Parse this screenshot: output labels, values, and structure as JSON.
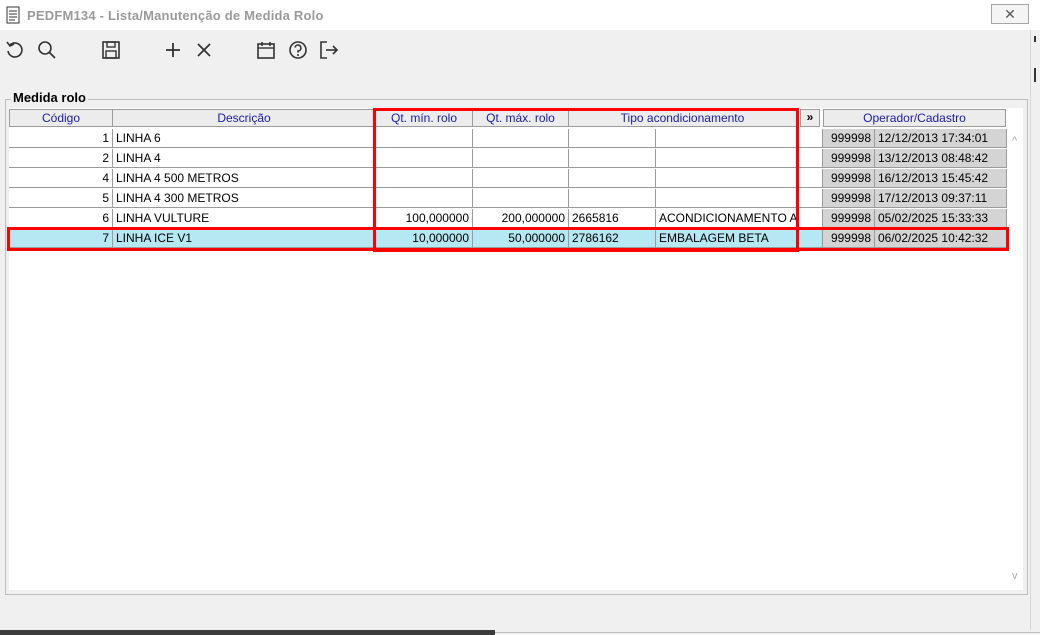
{
  "window": {
    "title": "PEDFM134 - Lista/Manutenção de Medida Rolo",
    "close_label": "✕"
  },
  "toolbar": {
    "icons": [
      "undo-icon",
      "search-icon",
      "save-icon",
      "add-icon",
      "delete-icon",
      "calendar-icon",
      "help-icon",
      "exit-icon"
    ]
  },
  "group": {
    "label": "Medida rolo"
  },
  "table": {
    "headers": {
      "codigo": "Código",
      "descricao": "Descrição",
      "qt_min": "Qt. mín. rolo",
      "qt_max": "Qt. máx. rolo",
      "tipo": "Tipo acondicionamento",
      "more": "»",
      "operador": "Operador/Cadastro"
    },
    "rows": [
      {
        "codigo": "1",
        "descricao": "LINHA 6",
        "qt_min": "",
        "qt_max": "",
        "tipo_cod": "",
        "tipo_desc": "",
        "operador": "999998",
        "cadastro": "12/12/2013 17:34:01"
      },
      {
        "codigo": "2",
        "descricao": "LINHA 4",
        "qt_min": "",
        "qt_max": "",
        "tipo_cod": "",
        "tipo_desc": "",
        "operador": "999998",
        "cadastro": "13/12/2013 08:48:42"
      },
      {
        "codigo": "4",
        "descricao": "LINHA 4 500 METROS",
        "qt_min": "",
        "qt_max": "",
        "tipo_cod": "",
        "tipo_desc": "",
        "operador": "999998",
        "cadastro": "16/12/2013 15:45:42"
      },
      {
        "codigo": "5",
        "descricao": "LINHA 4 300 METROS",
        "qt_min": "",
        "qt_max": "",
        "tipo_cod": "",
        "tipo_desc": "",
        "operador": "999998",
        "cadastro": "17/12/2013 09:37:11"
      },
      {
        "codigo": "6",
        "descricao": "LINHA VULTURE",
        "qt_min": "100,000000",
        "qt_max": "200,000000",
        "tipo_cod": "2665816",
        "tipo_desc": "ACONDICIONAMENTO ALP",
        "operador": "999998",
        "cadastro": "05/02/2025 15:33:33"
      },
      {
        "codigo": "7",
        "descricao": "LINHA ICE V1",
        "qt_min": "10,000000",
        "qt_max": "50,000000",
        "tipo_cod": "2786162",
        "tipo_desc": "EMBALAGEM BETA",
        "operador": "999998",
        "cadastro": "06/02/2025 10:42:32"
      }
    ]
  },
  "colors": {
    "selected_row": "#b5e8f3",
    "highlight": "#ff0000",
    "header_text": "#1a1aa6"
  }
}
